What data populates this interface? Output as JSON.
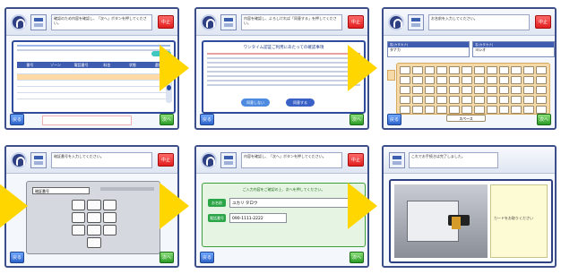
{
  "screens": {
    "s1": {
      "header": "確認のため内容を確認し、「次へ」ボタンを押してください。",
      "close_label": "中止",
      "table_headers": [
        "番号",
        "ゾーン",
        "電話番号",
        "料金",
        "状態",
        "選択"
      ],
      "back_label": "戻る",
      "next_label": "次へ"
    },
    "s2": {
      "header": "内容を確認し、よろしければ「同意する」を押してください。",
      "close_label": "中止",
      "title": "ワンタイム認証ご利用にあたっての確認事項",
      "btn_disagree": "同意しない",
      "btn_agree": "同意する",
      "back_label": "戻る",
      "next_label": "次へ"
    },
    "s3": {
      "header": "お名前を入力してください。",
      "close_label": "中止",
      "field1_label": "姓(カタカナ)",
      "field1_value": "タナカ",
      "field2_label": "名(カタカナ)",
      "field2_value": "ヨシオ",
      "space_label": "スペース",
      "back_label": "戻る",
      "next_label": "次へ"
    },
    "s4": {
      "header": "暗証番号を入力してください。",
      "close_label": "中止",
      "pin_label": "暗証番号",
      "keypad": [
        "1",
        "2",
        "3",
        "4",
        "5",
        "6",
        "7",
        "8",
        "9",
        "0"
      ],
      "back_label": "戻る",
      "next_label": "次へ"
    },
    "s5": {
      "header": "内容を確認し、「次へ」ボタンを押してください。",
      "close_label": "中止",
      "caption": "ご入力内容をご確認の上、次へを押してください。",
      "name_label": "お名前",
      "name_value": "ユカリ タロウ",
      "phone_label": "電話番号",
      "phone_value": "090-1111-2222",
      "back_label": "戻る",
      "next_label": "次へ"
    },
    "s6": {
      "header": "これでお手続きは完了しました。",
      "note": "カードをお取りください"
    }
  }
}
